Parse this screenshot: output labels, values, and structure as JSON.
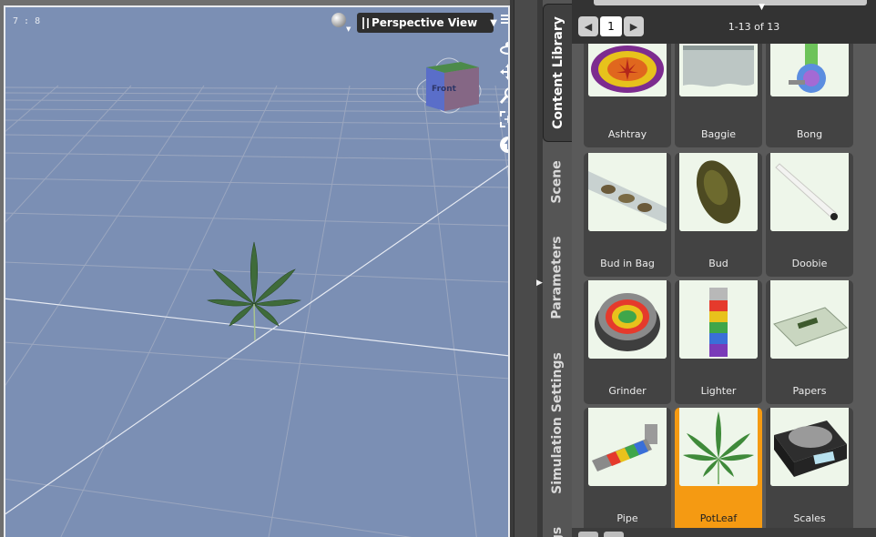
{
  "viewport": {
    "frame_counter": "7 : 8",
    "view_label": "Perspective View",
    "cube_face": "Front",
    "background": "#7b8fb4"
  },
  "side_tabs": [
    {
      "label": "Content Library",
      "active": true
    },
    {
      "label": "Scene",
      "active": false
    },
    {
      "label": "Parameters",
      "active": false
    },
    {
      "label": "Simulation Settings",
      "active": false
    },
    {
      "label": "gs",
      "active": false
    }
  ],
  "library": {
    "page": "1",
    "result_count": "1-13 of 13",
    "items": [
      {
        "label": "Ashtray",
        "icon": "ashtray-thumbnail"
      },
      {
        "label": "Baggie",
        "icon": "baggie-thumbnail"
      },
      {
        "label": "Bong",
        "icon": "bong-thumbnail"
      },
      {
        "label": "Bud in Bag",
        "icon": "bud-in-bag-thumbnail"
      },
      {
        "label": "Bud",
        "icon": "bud-thumbnail"
      },
      {
        "label": "Doobie",
        "icon": "doobie-thumbnail"
      },
      {
        "label": "Grinder",
        "icon": "grinder-thumbnail"
      },
      {
        "label": "Lighter",
        "icon": "lighter-thumbnail"
      },
      {
        "label": "Papers",
        "icon": "papers-thumbnail"
      },
      {
        "label": "Pipe",
        "icon": "pipe-thumbnail"
      },
      {
        "label": "PotLeaf",
        "icon": "potleaf-thumbnail",
        "selected": true
      },
      {
        "label": "Scales",
        "icon": "scales-thumbnail"
      }
    ],
    "selected_color": "#f59a12"
  }
}
